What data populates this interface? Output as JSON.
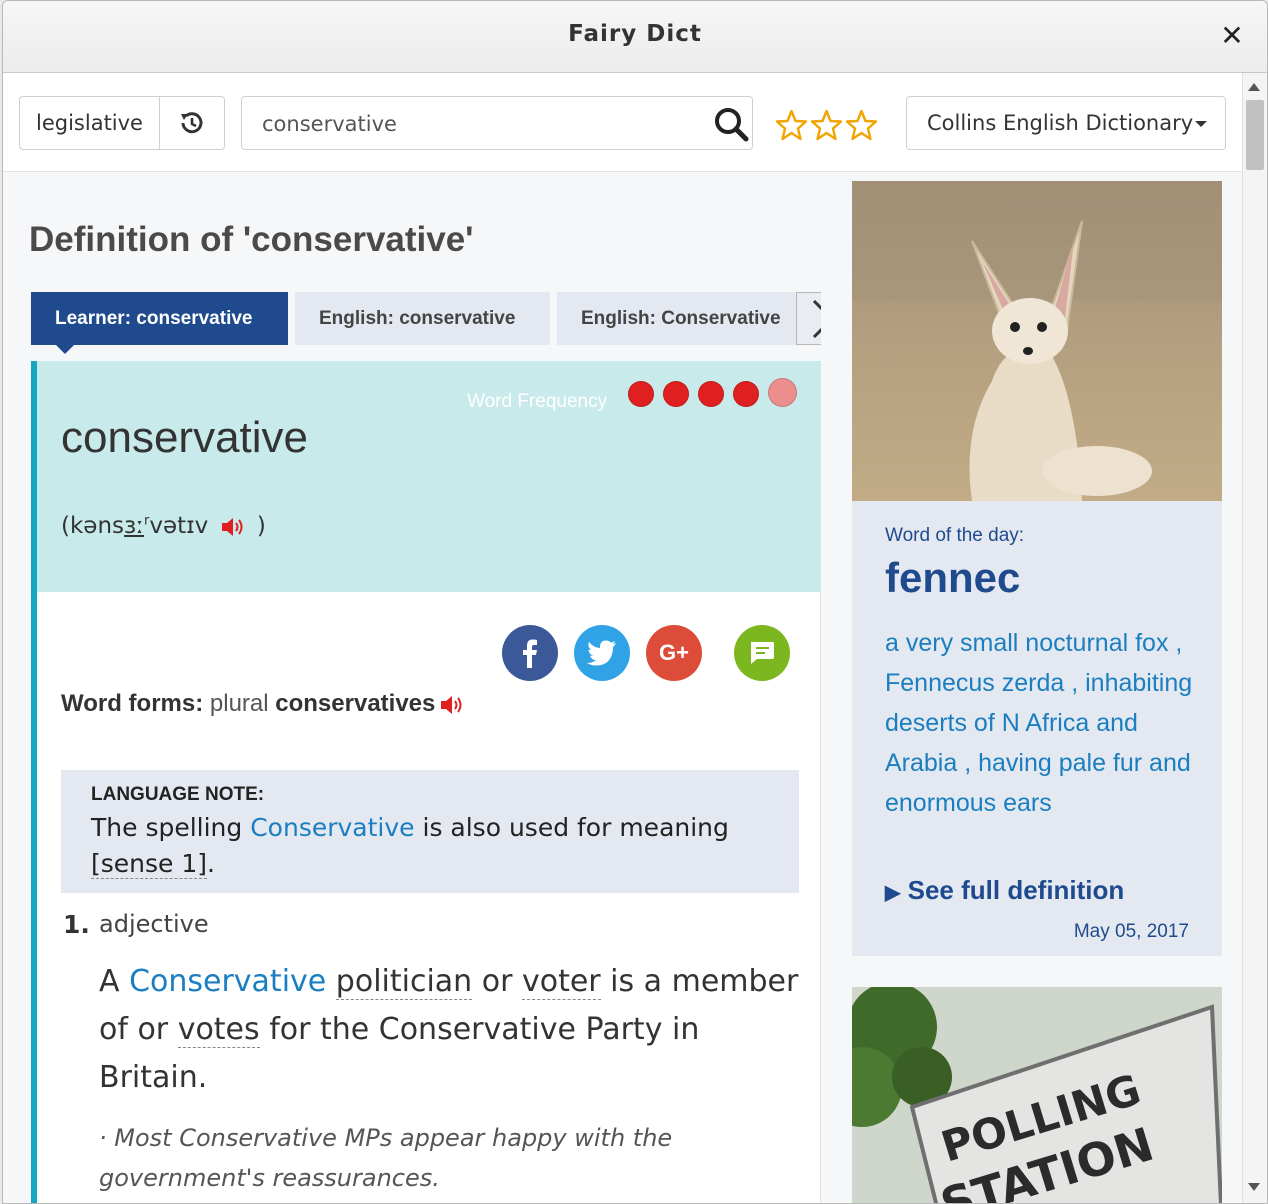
{
  "window": {
    "title": "Fairy Dict"
  },
  "toolbar": {
    "history_word": "legislative",
    "search_value": "conservative",
    "dictionary": "Collins English Dictionary",
    "stars": 3
  },
  "entry": {
    "page_title": "Definition of 'conservative'",
    "tabs": [
      "Learner: conservative",
      "English: conservative",
      "English: Conservative"
    ],
    "freq_label": "Word Frequency",
    "freq_level": 4,
    "freq_max": 5,
    "headword": "conservative",
    "pron_open": "(kəns",
    "pron_u": "ɜː",
    "pron_sup": "r",
    "pron_rest": "vətɪv",
    "pron_close": ")",
    "wf_label": "Word forms:",
    "wf_plural": "plural",
    "wf_form": "conservatives",
    "note_label": "LANGUAGE NOTE:",
    "note_pre": "The spelling ",
    "note_link": "Conservative",
    "note_mid": " is also used for meaning",
    "note_ref": "[sense 1]",
    "note_end": ".",
    "sense_num": "1.",
    "sense_pos": "adjective",
    "def_a": "A ",
    "def_link": "Conservative",
    "def_w1": "politician",
    "def_or": " or ",
    "def_w2": "voter",
    "def_is": " is a member of or ",
    "def_w3": "votes",
    "def_rest": " for the Conservative Party in Britain.",
    "example": "· Most Conservative MPs appear happy with the government's reassurances."
  },
  "wotd": {
    "label": "Word of the day:",
    "word": "fennec",
    "definition": "a very small nocturnal fox , Fennecus zerda , inhabiting deserts of N Africa and Arabia , having pale fur and enormous ears",
    "more": "See full definition",
    "date": "May 05, 2017"
  },
  "poll_sign": {
    "line1": "POLLING",
    "line2": "STATION"
  },
  "colors": {
    "brand": "#1f4b8e",
    "accent": "#15a7c0",
    "link": "#1a7ec0",
    "freq": "#e02020"
  },
  "icons": [
    "close-icon",
    "history-icon",
    "search-icon",
    "star-icon",
    "chevron-right-icon",
    "speaker-icon",
    "facebook-icon",
    "twitter-icon",
    "google-plus-icon",
    "comment-icon"
  ]
}
